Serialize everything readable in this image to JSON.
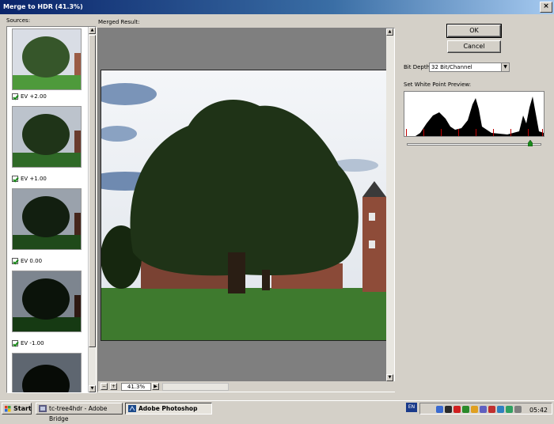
{
  "window": {
    "title": "Merge to HDR (41.3%)"
  },
  "labels": {
    "sources": "Sources:",
    "merged_result": "Merged Result:"
  },
  "sources": [
    {
      "ev": "EV +2.00"
    },
    {
      "ev": "EV +1.00"
    },
    {
      "ev": "EV 0.00"
    },
    {
      "ev": "EV -1.00"
    }
  ],
  "buttons": {
    "ok": "OK",
    "cancel": "Cancel"
  },
  "bit_depth": {
    "label": "Bit Depth:",
    "value": "32 Bit/Channel"
  },
  "white_point": {
    "label": "Set White Point Preview:",
    "slider_fraction": 0.92
  },
  "zoom": {
    "value": "41.3%",
    "minus": "−",
    "plus": "+"
  },
  "taskbar": {
    "start": "Start",
    "tasks": [
      {
        "label": "tc-tree4hdr - Adobe Bridge"
      },
      {
        "label": "Adobe Photoshop"
      }
    ],
    "language": "EN",
    "clock": "05:42"
  },
  "colors": {
    "title_bar": "#0a246a",
    "face": "#d4d0c8",
    "canvas": "#7f7f7f"
  }
}
